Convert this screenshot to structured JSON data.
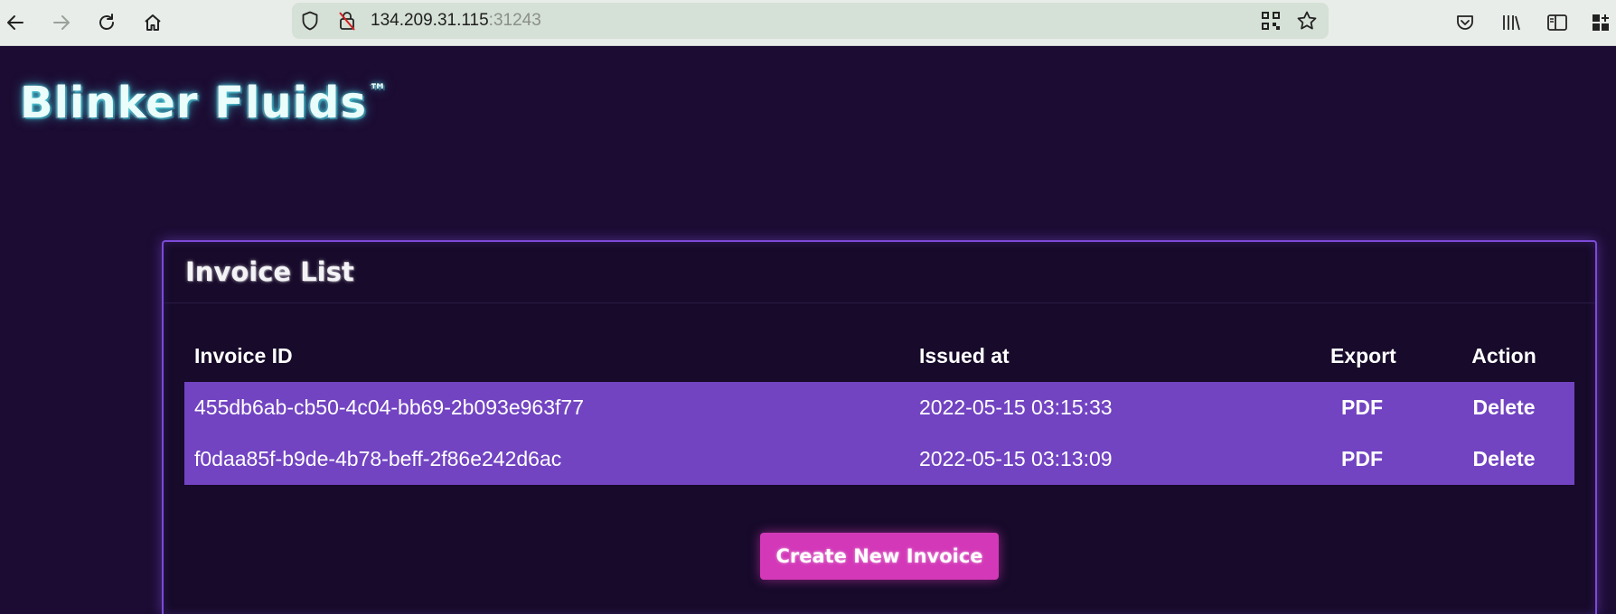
{
  "browser": {
    "url_host": "134.209.31.115",
    "url_port": ":31243",
    "icons": {
      "back": "back-arrow-icon",
      "forward": "forward-arrow-icon",
      "reload": "reload-icon",
      "home": "home-icon",
      "shield": "tracking-shield-icon",
      "insecure_lock": "insecure-lock-icon",
      "qr": "qr-code-icon",
      "bookmark": "star-icon",
      "pocket": "pocket-icon",
      "library": "library-icon",
      "sidebar": "sidebar-icon",
      "extensions": "extensions-icon"
    }
  },
  "brand": {
    "name": "Blinker Fluids",
    "trademark": "™"
  },
  "invoice_card": {
    "title": "Invoice List",
    "columns": {
      "id": "Invoice ID",
      "issued": "Issued at",
      "export": "Export",
      "action": "Action"
    },
    "rows": [
      {
        "id": "455db6ab-cb50-4c04-bb69-2b093e963f77",
        "issued": "2022-05-15 03:15:33",
        "export": "PDF",
        "action": "Delete"
      },
      {
        "id": "f0daa85f-b9de-4b78-beff-2f86e242d6ac",
        "issued": "2022-05-15 03:13:09",
        "export": "PDF",
        "action": "Delete"
      }
    ],
    "create_button": "Create New Invoice"
  },
  "colors": {
    "page_background": "#1c0c33",
    "card_border": "#7c4ad8",
    "row_background": "#7244c2",
    "button_background": "#d338b8",
    "brand_glow": "#49d9e6"
  }
}
